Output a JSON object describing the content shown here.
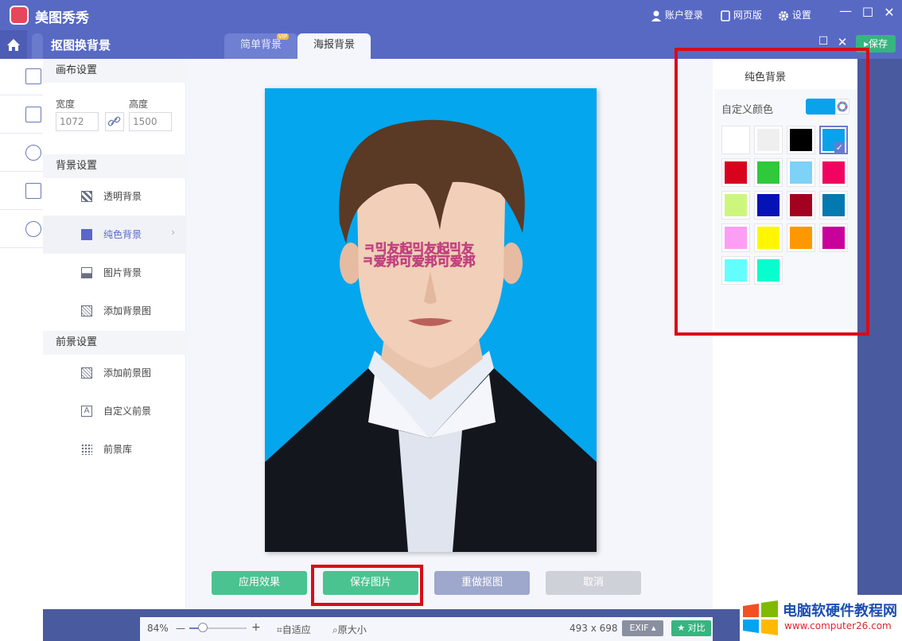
{
  "app": {
    "title": "美图秀秀"
  },
  "topbar": {
    "login": "账户登录",
    "web": "网页版",
    "settings": "设置"
  },
  "panel": {
    "title": "抠图换背景",
    "save": "保存"
  },
  "tabs": [
    {
      "label": "简单背景",
      "badge": "VIP"
    },
    {
      "label": "海报背景"
    }
  ],
  "sidebar": {
    "canvas_section": "画布设置",
    "width_label": "宽度",
    "width_value": "1072",
    "height_label": "高度",
    "height_value": "1500",
    "bg_section": "背景设置",
    "bg_items": [
      {
        "label": "透明背景",
        "icon": "checker-icon"
      },
      {
        "label": "纯色背景",
        "icon": "solid-square-icon",
        "active": true
      },
      {
        "label": "图片背景",
        "icon": "image-icon"
      },
      {
        "label": "添加背景图",
        "icon": "hatched-image-icon"
      }
    ],
    "fg_section": "前景设置",
    "fg_items": [
      {
        "label": "添加前景图",
        "icon": "add-image-icon"
      },
      {
        "label": "自定义前景",
        "icon": "text-a-icon"
      },
      {
        "label": "前景库",
        "icon": "library-icon"
      }
    ]
  },
  "right": {
    "title": "纯色背景",
    "custom_label": "自定义颜色",
    "custom_color": "#0aa2ea",
    "swatches": [
      "#ffffff",
      "#efefef",
      "#000000",
      "#0aa2ea",
      "#d9021d",
      "#2fc93b",
      "#7ed1f7",
      "#f1045f",
      "#cdf77c",
      "#0512b6",
      "#a2021f",
      "#0379b1",
      "#fc9ef3",
      "#fef701",
      "#fd9800",
      "#c9019b",
      "#64fdfe",
      "#07fdcd"
    ],
    "selected_index": 3
  },
  "photo": {
    "bg_color": "#04a6ee",
    "overlay_text_1": "ㅋ믹友起믹友起믹友",
    "overlay_text_2": "ㅋ爱邦可爱邦可爱邦"
  },
  "actions": {
    "apply": "应用效果",
    "save_image": "保存图片",
    "redo": "重做抠图",
    "cancel": "取消"
  },
  "statusbar": {
    "zoom": "84%",
    "fit": "自适应",
    "original": "原大小",
    "dims": "493 x 698",
    "exif": "EXIF",
    "compare": "对比"
  },
  "watermark": {
    "line1": "电脑软硬件教程网",
    "line2": "www.computer26.com"
  }
}
